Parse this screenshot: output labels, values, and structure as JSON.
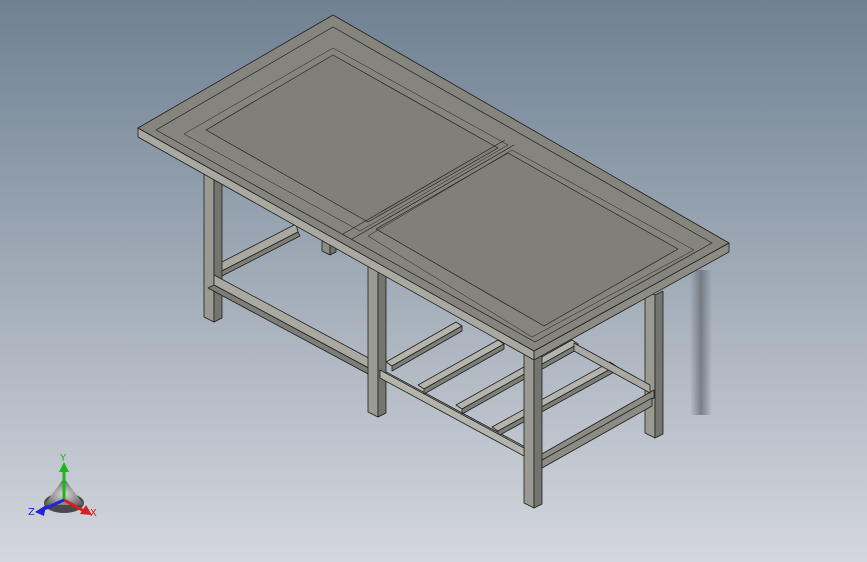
{
  "viewport": {
    "background_top": "#6f8193",
    "background_bottom": "#d4d7dd"
  },
  "model": {
    "icon": "workbench-table-model",
    "top_face_color": "#85857d",
    "side_color": "#a9a9a2",
    "leg_color": "#8c8c85",
    "edge_color": "#1e1e1e"
  },
  "triad": {
    "x_label": "X",
    "y_label": "Y",
    "z_label": "Z",
    "x_color": "#d62020",
    "y_color": "#18b818",
    "z_color": "#2424d4"
  }
}
